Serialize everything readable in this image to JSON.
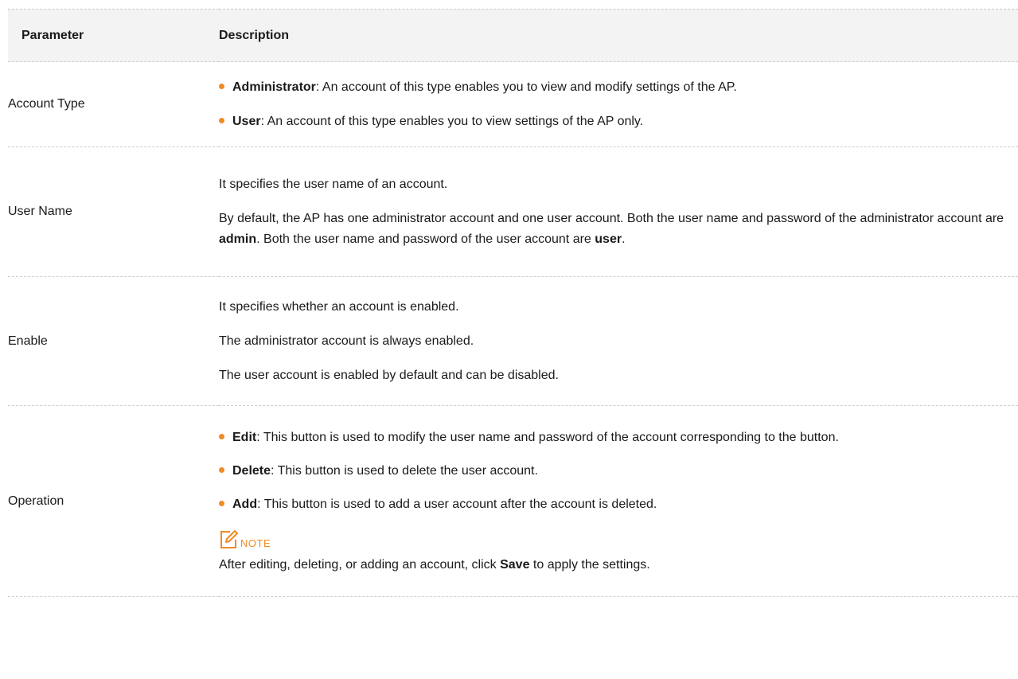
{
  "header": {
    "parameter": "Parameter",
    "description": "Description"
  },
  "rows": [
    {
      "parameter": "Account Type",
      "bullets": [
        {
          "term": "Administrator",
          "text": ": An account of this type enables you to view and modify settings of the AP."
        },
        {
          "term": "User",
          "text": ": An account of this type enables you to view settings of the AP only."
        }
      ]
    },
    {
      "parameter": "User Name",
      "p1": "It specifies the user name of an account.",
      "p2_a": "By default, the AP has one administrator account and one user account. Both the user name and password of the administrator account are ",
      "p2_b": "admin",
      "p2_c": ". Both the user name and password of the user account are ",
      "p2_d": "user",
      "p2_e": "."
    },
    {
      "parameter": "Enable",
      "p1": "It specifies whether an account is enabled.",
      "p2": "The administrator account is always enabled.",
      "p3": "The user account is enabled by default and can be disabled."
    },
    {
      "parameter": "Operation",
      "bullets": [
        {
          "term": "Edit",
          "text": ": This button is used to modify the user name and password of the account corresponding to the button."
        },
        {
          "term": "Delete",
          "text": ": This button is used to delete the user account."
        },
        {
          "term": "Add",
          "text": ": This button is used to add a user account after the account is deleted."
        }
      ],
      "note_label": "NOTE",
      "note_a": "After editing, deleting, or adding an account, click ",
      "note_b": "Save",
      "note_c": " to apply the settings."
    }
  ],
  "colors": {
    "accent": "#f08a24",
    "header_bg": "#f3f3f3",
    "text": "#1a1a1a"
  },
  "icons": {
    "note": "note-pencil-icon",
    "bullet": "orange-dot"
  }
}
